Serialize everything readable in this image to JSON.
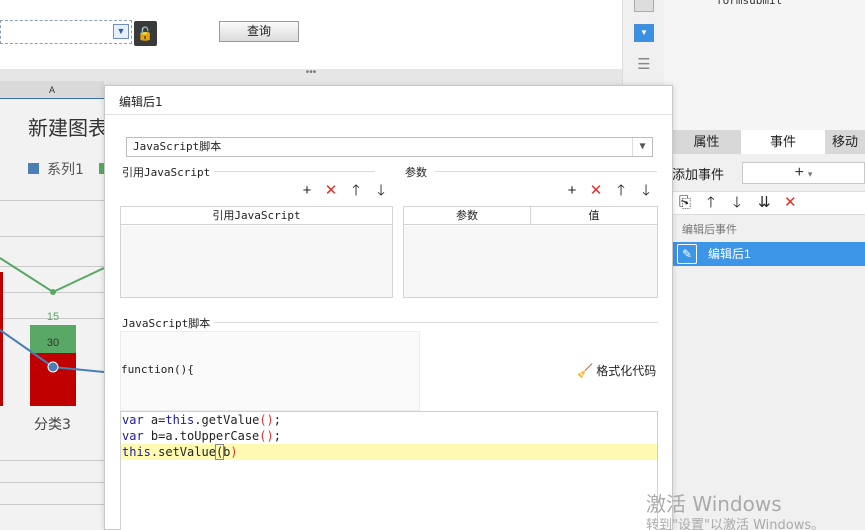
{
  "designer": {
    "query_button": "查询",
    "divider_dots": "•••"
  },
  "right_panel": {
    "tree_item": "formsubmit",
    "tabs": [
      "属性",
      "事件",
      "移动"
    ],
    "add_event_label": "添加事件",
    "add_event_value": "+",
    "event_group": "编辑后事件",
    "event_item": "编辑后1"
  },
  "background_chart": {
    "column_header": "A",
    "title": "新建图表",
    "legend": [
      "系列1"
    ],
    "category_label": "分类3",
    "colors": {
      "series1": "#4a7fb5",
      "series2": "#5aa866",
      "bar_red": "#c00000"
    }
  },
  "chart_data": {
    "type": "bar",
    "title": "新建图表",
    "categories": [
      "分类3"
    ],
    "series": [
      {
        "name": "系列1",
        "values": [
          30
        ]
      },
      {
        "name": "",
        "values": [
          15
        ]
      }
    ]
  },
  "dialog": {
    "title": "编辑后1",
    "type_select": "JavaScript脚本",
    "ref_js_group": "引用JavaScript",
    "ref_js_column": "引用JavaScript",
    "params_group": "参数",
    "params_columns": [
      "参数",
      "值"
    ],
    "script_group": "JavaScript脚本",
    "function_header": "function(){",
    "format_button": "格式化代码",
    "code": {
      "line1_kw": "var",
      "line1_rest": " a=",
      "line1_this": "this",
      "line1_tail": ".getValue",
      "line1_paren": "()",
      "line1_end": ";",
      "line2_kw": "var",
      "line2_rest": " b=a.toUpperCase",
      "line2_paren": "()",
      "line2_end": ";",
      "line3_this": "this",
      "line3_tail": ".setValue",
      "line3_open": "(",
      "line3_arg": "b",
      "line3_close": ")"
    }
  },
  "watermark": {
    "line1": "激活 Windows",
    "line2": "转到\"设置\"以激活 Windows。"
  }
}
